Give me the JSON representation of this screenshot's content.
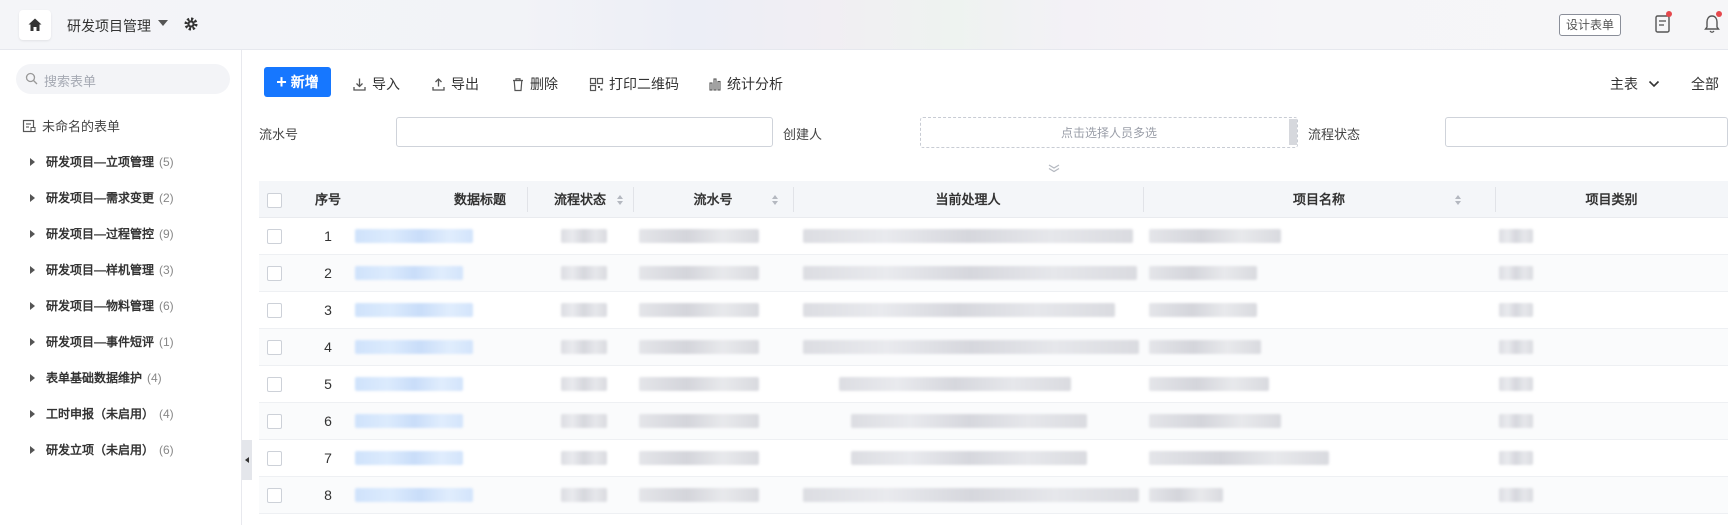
{
  "topbar": {
    "app_title": "研发项目管理",
    "design_button": "设计表单",
    "accent_red": "#e5484d"
  },
  "sidebar": {
    "search_placeholder": "搜索表单",
    "unnamed_form": "未命名的表单",
    "items": [
      {
        "label": "研发项目—立项管理",
        "count": "(5)"
      },
      {
        "label": "研发项目—需求变更",
        "count": "(2)"
      },
      {
        "label": "研发项目—过程管控",
        "count": "(9)"
      },
      {
        "label": "研发项目—样机管理",
        "count": "(3)"
      },
      {
        "label": "研发项目—物料管理",
        "count": "(6)"
      },
      {
        "label": "研发项目—事件短评",
        "count": "(1)"
      },
      {
        "label": "表单基础数据维护",
        "count": "(4)"
      },
      {
        "label": "工时申报（未启用）",
        "count": "(4)"
      },
      {
        "label": "研发立项（未启用）",
        "count": "(6)"
      }
    ]
  },
  "toolbar": {
    "new_label": "新增",
    "import_label": "导入",
    "export_label": "导出",
    "delete_label": "删除",
    "qrcode_label": "打印二维码",
    "stats_label": "统计分析",
    "view_label": "主表",
    "all_label": "全部",
    "primary_color": "#1677ff"
  },
  "filters": {
    "serial_label": "流水号",
    "creator_label": "创建人",
    "creator_placeholder": "点击选择人员多选",
    "status_label": "流程状态"
  },
  "table": {
    "headers": {
      "index": "序号",
      "title": "数据标题",
      "status": "流程状态",
      "serial": "流水号",
      "handler": "当前处理人",
      "project": "项目名称",
      "category": "项目类别"
    },
    "rows": [
      {
        "index": "1"
      },
      {
        "index": "2"
      },
      {
        "index": "3"
      },
      {
        "index": "4"
      },
      {
        "index": "5"
      },
      {
        "index": "6"
      },
      {
        "index": "7"
      },
      {
        "index": "8"
      }
    ]
  }
}
